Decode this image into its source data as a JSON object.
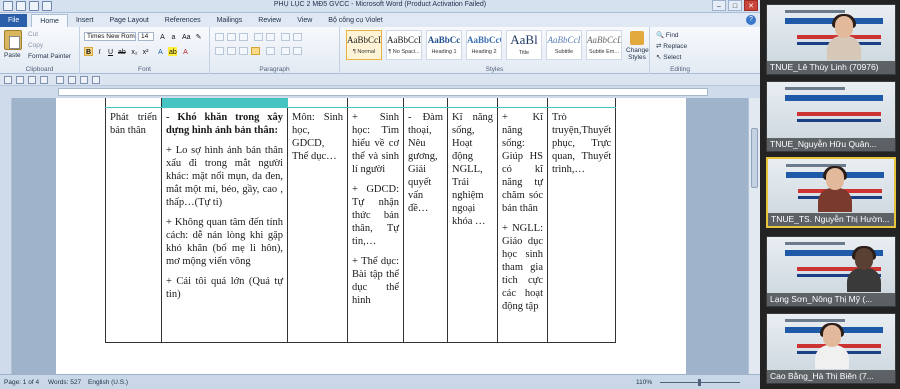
{
  "window": {
    "title": "PHỤ LỤC 2 MĐ5 GVCC - Microsoft Word (Product Activation Failed)",
    "controls": [
      "–",
      "□",
      "✕"
    ]
  },
  "ribbon_tabs": [
    "File",
    "Home",
    "Insert",
    "Page Layout",
    "References",
    "Mailings",
    "Review",
    "View",
    "Bộ công cụ Violet"
  ],
  "ribbon": {
    "clipboard": {
      "paste": "Paste",
      "cut": "Cut",
      "copy": "Copy",
      "format_painter": "Format Painter",
      "label": "Clipboard"
    },
    "font": {
      "name": "Times New Rom",
      "size": "14",
      "label": "Font"
    },
    "paragraph": {
      "label": "Paragraph"
    },
    "styles": {
      "items": [
        {
          "sample": "AaBbCcDc",
          "name": "¶ Normal"
        },
        {
          "sample": "AaBbCcDc",
          "name": "¶ No Spaci..."
        },
        {
          "sample": "AaBbCc",
          "name": "Heading 1"
        },
        {
          "sample": "AaBbCcC",
          "name": "Heading 2"
        },
        {
          "sample": "AaBl",
          "name": "Title"
        },
        {
          "sample": "AaBbCcI",
          "name": "Subtitle"
        },
        {
          "sample": "AaBbCcDc",
          "name": "Subtle Em..."
        }
      ],
      "change_styles": "Change Styles",
      "label": "Styles"
    },
    "editing": {
      "find": "Find",
      "replace": "Replace",
      "select": "Select",
      "label": "Editing"
    }
  },
  "table": {
    "rows": [
      {
        "cells": [
          [
            "Phát triển bản thân"
          ],
          [
            "- Khó khăn trong xây dựng hình ảnh bản thân:",
            "+ Lo sợ hình ảnh bản thân xấu đi trong mắt người khác: mặt nổi mụn, da đen, mắt một mí, béo, gầy, cao , thấp…(Tự ti)",
            "+ Không quan tâm đến tính cách: dễ nản lòng khi gặp khó khăn (bố mẹ li hôn), mơ mộng viển vông",
            "+ Cái tôi quá lớn (Quá tự tin)"
          ],
          [
            "Môn: Sinh học, GDCD, Thể dục…"
          ],
          [
            "+ Sinh học: Tìm hiểu về cơ thể và sinh lí người",
            "+ GDCD: Tự nhận thức bản thân, Tự tin,…",
            "+ Thể dục: Bài tập thể dục thể hình"
          ],
          [
            "- Đàm thoại, Nêu gương, Giải quyết vấn đề…"
          ],
          [
            "Kĩ năng sống, Hoạt động NGLL, Trải nghiệm ngoại khóa …"
          ],
          [
            "+ Kĩ năng sống: Giúp HS có kĩ năng tự chăm sóc bản thân",
            "+ NGLL: Giáo dục học sinh tham gia tích cực các hoạt động tập"
          ],
          [
            "Trò truyện,Thuyết phục, Trực quan, Thuyết trình,…"
          ]
        ]
      }
    ]
  },
  "status_bar": {
    "page": "Page: 1 of 4",
    "words": "Words: 527",
    "language": "English (U.S.)",
    "zoom": "110%"
  },
  "participants": [
    {
      "name": "TNUE_Lê Thùy Linh (70976)",
      "active": false
    },
    {
      "name": "TNUE_Nguyễn Hữu Quân...",
      "active": false
    },
    {
      "name": "TNUE_TS. Nguyễn Thị Hườn...",
      "active": true
    },
    {
      "name": "Lạng Sơn_Nông Thị Mỹ (...",
      "active": false
    },
    {
      "name": "Cao Bằng_Hà Thị Biên (7...",
      "active": false
    }
  ],
  "colors": {
    "table_header_teal": "#46c4c2",
    "word_blue": "#2a5ea8",
    "active_speaker": "#e8c33c"
  }
}
